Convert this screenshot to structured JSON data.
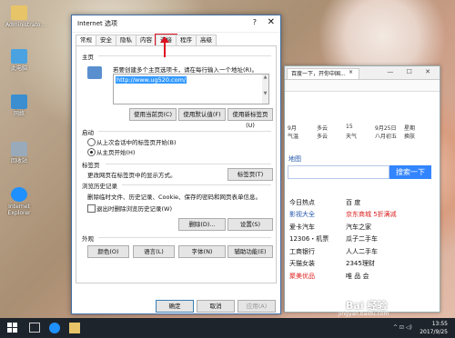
{
  "desktop": {
    "icons": [
      {
        "label": "Administrato...",
        "icon": "user-folder-icon",
        "color": "#e8c468"
      },
      {
        "label": "此电脑",
        "icon": "computer-icon",
        "color": "#4aa3e0"
      },
      {
        "label": "网络",
        "icon": "network-icon",
        "color": "#3b8fd0"
      },
      {
        "label": "回收站",
        "icon": "recycle-bin-icon",
        "color": "#9ab"
      },
      {
        "label": "Internet Explorer",
        "icon": "ie-icon",
        "color": "#1e90ff"
      }
    ]
  },
  "browser": {
    "tab_title": "百度一下，开你中国...",
    "tab_close": "×",
    "window_controls": "— ☐ ✕",
    "weather": {
      "row1": [
        "9月",
        "多云",
        "15",
        "9月25日",
        "星期"
      ],
      "row2": [
        "气温",
        "多云",
        "天气",
        "八月初五",
        "换肤"
      ]
    },
    "map_link": "地图",
    "search_button": "搜索一下",
    "links": [
      [
        "今日热点",
        "百 度"
      ],
      [
        "影视大全",
        "京东商城 5折满减"
      ],
      [
        "爱卡汽车",
        "汽车之家"
      ],
      [
        "12306・机票",
        "瓜子二手车"
      ],
      [
        "工商银行",
        "人人二手车"
      ],
      [
        "天猫女装",
        "2345理财"
      ],
      [
        "聚美优品",
        "唯 品 会"
      ]
    ]
  },
  "dialog": {
    "title": "Internet 选项",
    "help": "?",
    "close": "✕",
    "tabs": [
      "常规",
      "安全",
      "隐私",
      "内容",
      "连接",
      "程序",
      "高级"
    ],
    "active_tab": "常规",
    "highlighted_tab": "连接",
    "homepage": {
      "section": "主页",
      "description": "若要创建多个主页选项卡，请在每行输入一个地址(R)。",
      "url": "http://www.ug520.com/",
      "btn_current": "使用当前页(C)",
      "btn_default": "使用默认值(F)",
      "btn_newtab": "使用新标签页(U)"
    },
    "startup": {
      "section": "启动",
      "option1": "从上次会话中的标签页开始(B)",
      "option2": "从主页开始(H)",
      "selected": 2
    },
    "tabs_section": {
      "section": "标签页",
      "description": "更改网页在标签页中的显示方式。",
      "button": "标签页(T)"
    },
    "history": {
      "section": "浏览历史记录",
      "description": "删除临时文件、历史记录、Cookie、保存的密码和网页表单信息。",
      "checkbox": "退出时删除浏览历史记录(W)",
      "btn_delete": "删除(D)...",
      "btn_settings": "设置(S)"
    },
    "appearance": {
      "section": "外观",
      "btn_colors": "颜色(O)",
      "btn_languages": "语言(L)",
      "btn_fonts": "字体(N)",
      "btn_accessibility": "辅助功能(E)"
    },
    "footer": {
      "ok": "确定",
      "cancel": "取消",
      "apply": "应用(A)"
    }
  },
  "taskbar": {
    "time": "13:55",
    "date": "2017/9/25",
    "tray": "^ ⊡ ◁)"
  },
  "watermark": {
    "logo": "Bai 经验",
    "site": "jingyan.baidu.com"
  },
  "colors": {
    "accent": "#3385ff",
    "highlight": "#dd1122",
    "selection": "#3399ff"
  }
}
